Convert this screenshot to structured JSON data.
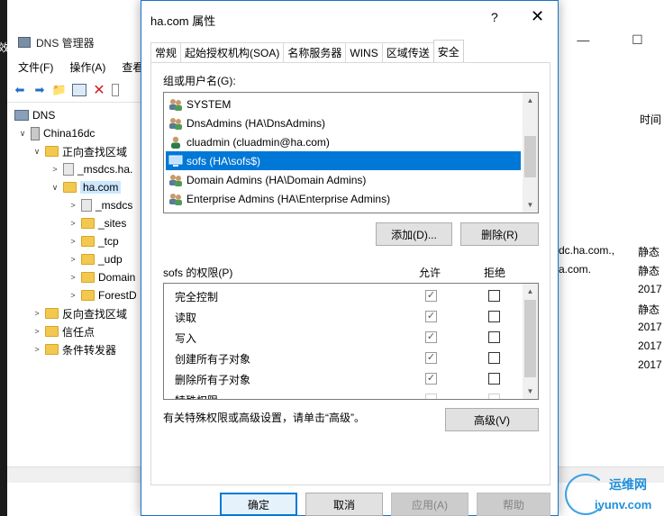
{
  "background": {
    "leftstrip_text": "效",
    "title": "DNS 管理器",
    "caption_buttons": [
      "—",
      "☐"
    ],
    "menu": [
      "文件(F)",
      "操作(A)",
      "查看"
    ],
    "tree": [
      {
        "label": "DNS",
        "indent": 0,
        "twisty": "",
        "icon": "dns"
      },
      {
        "label": "China16dc",
        "indent": 1,
        "twisty": "∨",
        "icon": "server"
      },
      {
        "label": "正向查找区域",
        "indent": 2,
        "twisty": "∨",
        "icon": "folder"
      },
      {
        "label": "_msdcs.ha.",
        "indent": 3,
        "twisty": ">",
        "icon": "zone"
      },
      {
        "label": "ha.com",
        "indent": 3,
        "twisty": "∨",
        "icon": "zone",
        "selected": true
      },
      {
        "label": "_msdcs",
        "indent": 4,
        "twisty": ">",
        "icon": "zone"
      },
      {
        "label": "_sites",
        "indent": 4,
        "twisty": ">",
        "icon": "folder"
      },
      {
        "label": "_tcp",
        "indent": 4,
        "twisty": ">",
        "icon": "folder"
      },
      {
        "label": "_udp",
        "indent": 4,
        "twisty": ">",
        "icon": "folder"
      },
      {
        "label": "Domain",
        "indent": 4,
        "twisty": ">",
        "icon": "folder"
      },
      {
        "label": "ForestD",
        "indent": 4,
        "twisty": ">",
        "icon": "folder"
      },
      {
        "label": "反向查找区域",
        "indent": 2,
        "twisty": ">",
        "icon": "folder"
      },
      {
        "label": "信任点",
        "indent": 2,
        "twisty": ">",
        "icon": "folder"
      },
      {
        "label": "条件转发器",
        "indent": 2,
        "twisty": ">",
        "icon": "folder"
      }
    ],
    "right_header": "时间",
    "right_col_a": [
      "dc.ha.com.,",
      "a.com."
    ],
    "right_col_b": [
      "静态",
      "静态",
      "2017",
      "静态",
      "2017",
      "2017",
      "2017"
    ]
  },
  "dialog": {
    "title": "ha.com 属性",
    "help": "?",
    "close": "✕",
    "tabs": [
      "常规",
      "起始授权机构(SOA)",
      "名称服务器",
      "WINS",
      "区域传送",
      "安全"
    ],
    "active_tab": 5,
    "group_label": "组或用户名(G):",
    "users": [
      {
        "label": "SYSTEM",
        "icon": "group"
      },
      {
        "label": "DnsAdmins (HA\\DnsAdmins)",
        "icon": "group"
      },
      {
        "label": "cluadmin (cluadmin@ha.com)",
        "icon": "user"
      },
      {
        "label": "sofs (HA\\sofs$)",
        "icon": "computer",
        "selected": true
      },
      {
        "label": "Domain Admins (HA\\Domain Admins)",
        "icon": "group"
      },
      {
        "label": "Enterprise Admins (HA\\Enterprise Admins)",
        "icon": "group"
      }
    ],
    "add_button": "添加(D)...",
    "remove_button": "删除(R)",
    "perm_label": "sofs 的权限(P)",
    "allow_header": "允许",
    "deny_header": "拒绝",
    "permissions": [
      {
        "name": "完全控制",
        "allow": true,
        "deny": false
      },
      {
        "name": "读取",
        "allow": true,
        "deny": false
      },
      {
        "name": "写入",
        "allow": true,
        "deny": false
      },
      {
        "name": "创建所有子对象",
        "allow": true,
        "deny": false
      },
      {
        "name": "删除所有子对象",
        "allow": true,
        "deny": false
      },
      {
        "name": "特殊权限",
        "allow": false,
        "deny": false,
        "partial": true
      }
    ],
    "advanced_hint": "有关特殊权限或高级设置，请单击“高级”。",
    "advanced_button": "高级(V)",
    "ok_button": "确定",
    "cancel_button": "取消",
    "apply_button": "应用(A)",
    "help_button": "帮助"
  },
  "watermark": {
    "line1": "运维网",
    "line2": "iyunv.com"
  },
  "colors": {
    "selection": "#0078d7",
    "accent_border": "#1a73c7",
    "folder": "#f3c851"
  }
}
